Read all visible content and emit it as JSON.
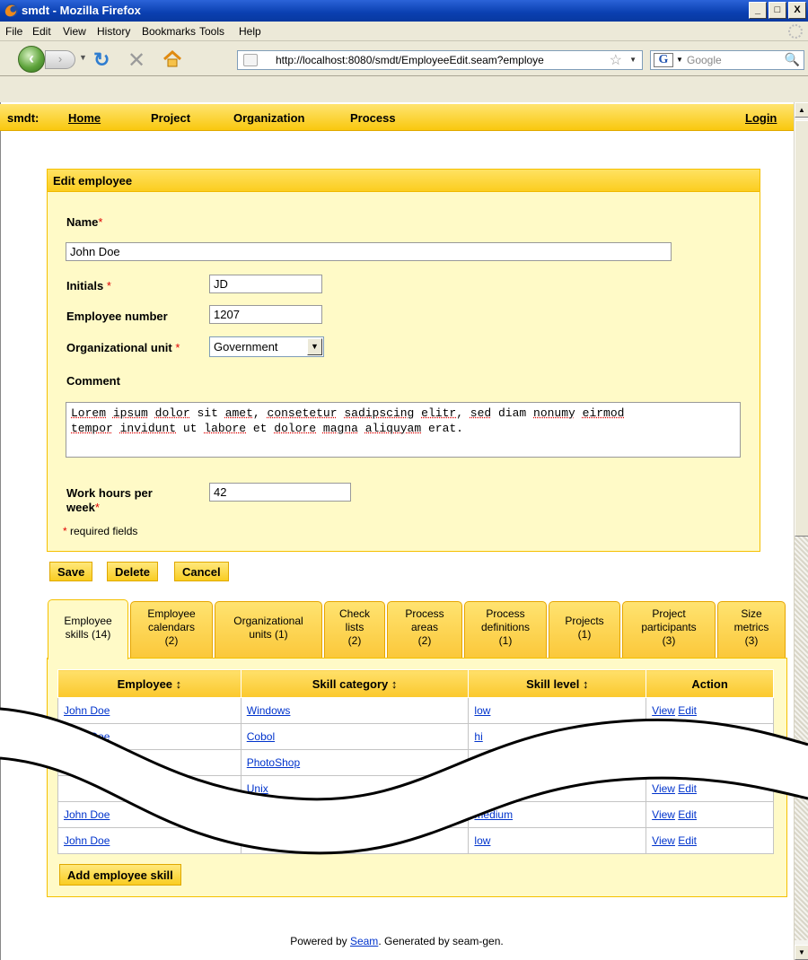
{
  "window": {
    "title": "smdt - Mozilla Firefox"
  },
  "menu": [
    "File",
    "Edit",
    "View",
    "History",
    "Bookmarks",
    "Tools",
    "Help"
  ],
  "browser": {
    "url": "http://localhost:8080/smdt/EmployeeEdit.seam?employe",
    "search_placeholder": "Google"
  },
  "appbar": {
    "brand": "smdt:",
    "links": [
      "Home",
      "Project",
      "Organization",
      "Process"
    ],
    "login": "Login"
  },
  "form": {
    "header": "Edit employee",
    "name_label": "Name",
    "name_value": "John Doe",
    "initials_label": "Initials",
    "initials_value": "JD",
    "employee_number_label": "Employee number",
    "employee_number_value": "1207",
    "org_unit_label": "Organizational unit",
    "org_unit_value": "Government",
    "comment_label": "Comment",
    "comment_line1": [
      "Lorem",
      " ",
      "ipsum",
      " ",
      "dolor",
      " sit ",
      "amet",
      ", ",
      "consetetur",
      " ",
      "sadipscing",
      " ",
      "elitr",
      ", ",
      "sed",
      " diam ",
      "nonumy",
      " ",
      "eirmod"
    ],
    "comment_line2": [
      "tempor",
      " ",
      "invidunt",
      " ut ",
      "labore",
      " et ",
      "dolore",
      " ",
      "magna",
      " ",
      "aliquyam",
      " erat."
    ],
    "work_hours_label_1": "Work hours per",
    "work_hours_label_2": "week",
    "work_hours_value": "42",
    "required_note": "required fields",
    "required_mark": "*"
  },
  "buttons": {
    "save": "Save",
    "delete": "Delete",
    "cancel": "Cancel",
    "add_skill": "Add employee skill"
  },
  "tabs": [
    {
      "l1": "Employee",
      "l2": "skills (14)",
      "l3": ""
    },
    {
      "l1": "Employee",
      "l2": "calendars",
      "l3": "(2)"
    },
    {
      "l1": "Organizational",
      "l2": "units (1)",
      "l3": ""
    },
    {
      "l1": "Check",
      "l2": "lists",
      "l3": "(2)"
    },
    {
      "l1": "Process",
      "l2": "areas",
      "l3": "(2)"
    },
    {
      "l1": "Process",
      "l2": "definitions",
      "l3": "(1)"
    },
    {
      "l1": "Projects",
      "l2": "(1)",
      "l3": ""
    },
    {
      "l1": "Project",
      "l2": "participants",
      "l3": "(3)"
    },
    {
      "l1": "Size",
      "l2": "metrics",
      "l3": "(3)"
    }
  ],
  "table": {
    "headers": [
      "Employee ↕",
      "Skill category ↕",
      "Skill level ↕",
      "Action"
    ],
    "rows": [
      [
        "John Doe",
        "Windows",
        "low",
        "View",
        "Edit"
      ],
      [
        "John Doe",
        "Cobol",
        "hi",
        "",
        ""
      ],
      [
        "",
        "PhotoShop",
        "",
        "View",
        "Edit"
      ],
      [
        "",
        "Unix",
        "medium",
        "View",
        "Edit"
      ],
      [
        "John Doe",
        "",
        "medium",
        "View",
        "Edit"
      ],
      [
        "John Doe",
        "PHP",
        "low",
        "View",
        "Edit"
      ]
    ]
  },
  "footer": {
    "prefix": "Powered by ",
    "link": "Seam",
    "suffix": ". Generated by seam-gen."
  }
}
